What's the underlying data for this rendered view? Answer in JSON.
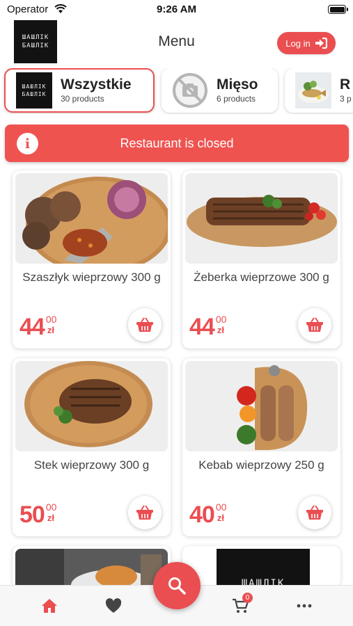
{
  "status_bar": {
    "carrier": "Operator",
    "time": "9:26 AM"
  },
  "header": {
    "logo_lines": [
      "ШAШЛIK",
      "БAШЛIK"
    ],
    "title": "Menu",
    "login_label": "Log in"
  },
  "categories": [
    {
      "name": "Wszystkie",
      "count": "30 products"
    },
    {
      "name": "Mięso",
      "count": "6 products"
    },
    {
      "name": "R",
      "count": "3 p"
    }
  ],
  "banner": {
    "text": "Restaurant is closed",
    "icon": "i"
  },
  "products": [
    {
      "name": "Szaszłyk wieprzowy 300 g",
      "price_main": "44",
      "price_cents": "00",
      "currency": "zł"
    },
    {
      "name": "Żeberka wieprzowe 300 g",
      "price_main": "44",
      "price_cents": "00",
      "currency": "zł"
    },
    {
      "name": "Stek wieprzowy 300 g",
      "price_main": "50",
      "price_cents": "00",
      "currency": "zł"
    },
    {
      "name": "Kebab wieprzowy 250 g",
      "price_main": "40",
      "price_cents": "00",
      "currency": "zł"
    }
  ],
  "partial_logo_text": "ШAШЛIK",
  "tab_bar": {
    "cart_count": "0"
  },
  "icons": [
    "wifi-icon",
    "battery-icon",
    "login-icon",
    "info-icon",
    "basket-icon",
    "home-icon",
    "heart-icon",
    "cart-icon",
    "more-icon",
    "search-icon"
  ],
  "colors": {
    "accent": "#ea4e51",
    "banner": "#ef5350"
  }
}
